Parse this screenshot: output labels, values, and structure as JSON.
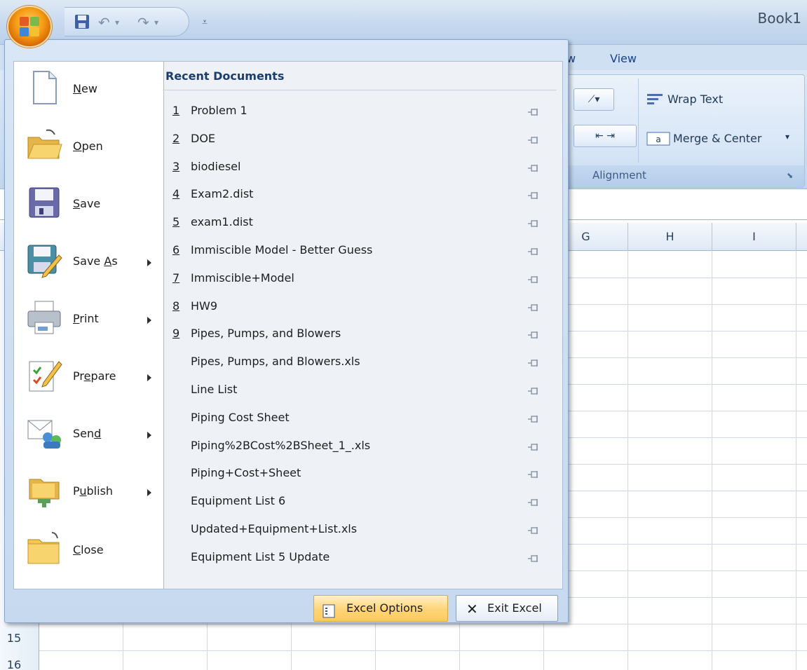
{
  "window": {
    "title": "Book1",
    "qat_icons": [
      "save-icon",
      "undo-icon",
      "redo-icon",
      "customize-qat-icon"
    ]
  },
  "ribbon": {
    "tabs": [
      "w",
      "View"
    ],
    "alignment": {
      "wrap_text": "Wrap Text",
      "merge_center": "Merge & Center",
      "group_label": "Alignment"
    }
  },
  "grid": {
    "columns": [
      "G",
      "H",
      "I"
    ],
    "rows": [
      "15",
      "16"
    ]
  },
  "office_menu": {
    "commands": [
      {
        "label": "New",
        "accel": "N",
        "icon": "new-document-icon",
        "submenu": false
      },
      {
        "label": "Open",
        "accel": "O",
        "icon": "open-folder-icon",
        "submenu": false
      },
      {
        "label": "Save",
        "accel": "S",
        "icon": "save-icon",
        "submenu": false
      },
      {
        "label": "Save As",
        "accel": "A",
        "icon": "save-as-icon",
        "submenu": true
      },
      {
        "label": "Print",
        "accel": "P",
        "icon": "printer-icon",
        "submenu": true
      },
      {
        "label": "Prepare",
        "accel": "e",
        "icon": "prepare-icon",
        "submenu": true
      },
      {
        "label": "Send",
        "accel": "d",
        "icon": "send-icon",
        "submenu": true
      },
      {
        "label": "Publish",
        "accel": "u",
        "icon": "publish-icon",
        "submenu": true
      },
      {
        "label": "Close",
        "accel": "C",
        "icon": "close-folder-icon",
        "submenu": false
      }
    ],
    "recent_title": "Recent Documents",
    "recent": [
      {
        "num": "1",
        "name": "Problem 1"
      },
      {
        "num": "2",
        "name": "DOE"
      },
      {
        "num": "3",
        "name": "biodiesel"
      },
      {
        "num": "4",
        "name": "Exam2.dist"
      },
      {
        "num": "5",
        "name": "exam1.dist"
      },
      {
        "num": "6",
        "name": "Immiscible Model - Better Guess"
      },
      {
        "num": "7",
        "name": "Immiscible+Model"
      },
      {
        "num": "8",
        "name": "HW9"
      },
      {
        "num": "9",
        "name": "Pipes, Pumps, and Blowers"
      },
      {
        "num": "",
        "name": "Pipes, Pumps, and Blowers.xls"
      },
      {
        "num": "",
        "name": "Line List"
      },
      {
        "num": "",
        "name": "Piping Cost Sheet"
      },
      {
        "num": "",
        "name": "Piping%2BCost%2BSheet_1_.xls"
      },
      {
        "num": "",
        "name": "Piping+Cost+Sheet"
      },
      {
        "num": "",
        "name": "Equipment List 6"
      },
      {
        "num": "",
        "name": "Updated+Equipment+List.xls"
      },
      {
        "num": "",
        "name": "Equipment List 5 Update"
      }
    ],
    "excel_options": "Excel Options",
    "exit_excel": "Exit Excel"
  }
}
